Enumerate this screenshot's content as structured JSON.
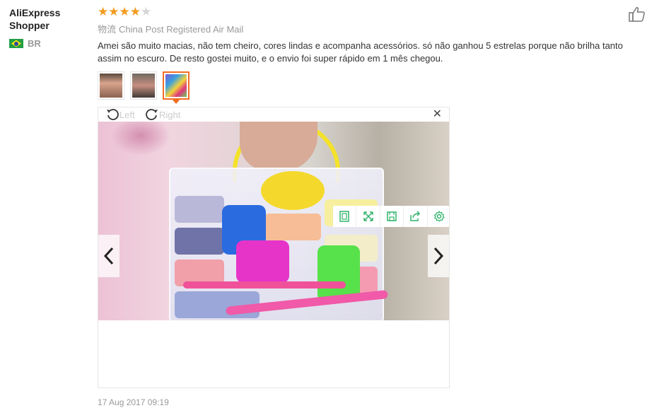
{
  "reviewer": {
    "name_line1": "AliExpress",
    "name_line2": "Shopper",
    "country_code": "BR",
    "flag_icon": "brazil-flag-icon"
  },
  "review": {
    "rating": 4,
    "max_rating": 5,
    "shipping_label": "物流",
    "shipping_method": "China Post Registered Air Mail",
    "comment": "Amei são muito macias, não tem cheiro, cores lindas e acompanha acessórios. só não ganhou 5 estrelas porque não brilha tanto assim no escuro. De resto gostei muito, e o envio foi super rápido em 1 mês chegou.",
    "date": "17 Aug 2017 09:19"
  },
  "thumbnails": [
    {
      "name": "review-photo-1",
      "selected": false
    },
    {
      "name": "review-photo-2",
      "selected": false
    },
    {
      "name": "review-photo-3",
      "selected": true
    }
  ],
  "viewer": {
    "rotate_left_label": "Left",
    "rotate_right_label": "Right",
    "close_icon": "close-icon",
    "toolbar_icons": [
      "fit-page-icon",
      "fullscreen-icon",
      "save-icon",
      "share-icon",
      "settings-icon"
    ],
    "prev_icon": "chevron-left-icon",
    "next_icon": "chevron-right-icon"
  },
  "colors": {
    "star": "#f29a1f",
    "star_off": "#d6d6d6",
    "accent": "#f26d22",
    "tool_icon": "#2fb36a"
  }
}
